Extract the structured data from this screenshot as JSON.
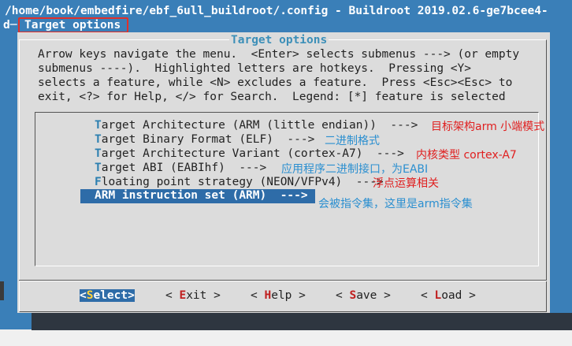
{
  "window": {
    "title_line1": "/home/book/embedfire/ebf_6ull_buildroot/.config - Buildroot 2019.02.6-ge7bcee4-",
    "title_line2_prefix": "d─",
    "breadcrumb": "Target options"
  },
  "dialog": {
    "title": "Target options",
    "help_lines": [
      "Arrow keys navigate the menu.  <Enter> selects submenus ---> (or empty",
      "submenus ----).  Highlighted letters are hotkeys.  Pressing <Y>",
      "selects a feature, while <N> excludes a feature.  Press <Esc><Esc> to",
      "exit, <?> for Help, </> for Search.  Legend: [*] feature is selected"
    ]
  },
  "menu": {
    "items": [
      {
        "hotkey": "T",
        "label": "arget Architecture (ARM (little endian))  --->"
      },
      {
        "hotkey": "T",
        "label": "arget Binary Format (ELF)  --->"
      },
      {
        "hotkey": "T",
        "label": "arget Architecture Variant (cortex-A7)  --->"
      },
      {
        "hotkey": "T",
        "label": "arget ABI (EABIhf)  --->"
      },
      {
        "hotkey": "F",
        "label": "loating point strategy (NEON/VFPv4)  --->"
      }
    ],
    "selected": {
      "hotkey": "A",
      "label": "RM instruction set (ARM)  --->"
    }
  },
  "annotations": [
    "目标架构arm 小端模式",
    "二进制格式",
    "内核类型 cortex-A7",
    "应用程序二进制接口，为EABI",
    "浮点运算相关",
    "会被指令集，这里是arm指令集"
  ],
  "buttons": {
    "select": {
      "pre": "<",
      "hot": "S",
      "post": "elect>"
    },
    "exit": {
      "pre": "< ",
      "hot": "E",
      "post": "xit >"
    },
    "help": {
      "pre": "< ",
      "hot": "H",
      "post": "elp >"
    },
    "save": {
      "pre": "< ",
      "hot": "S",
      "post": "ave >"
    },
    "load": {
      "pre": "< ",
      "hot": "L",
      "post": "oad >"
    }
  },
  "colors": {
    "terminal_bg": "#3a7fb8",
    "dialog_bg": "#dcdcdc",
    "selection": "#2e6ca8",
    "annotation_red": "#e02020",
    "annotation_blue": "#2b8fd0"
  }
}
